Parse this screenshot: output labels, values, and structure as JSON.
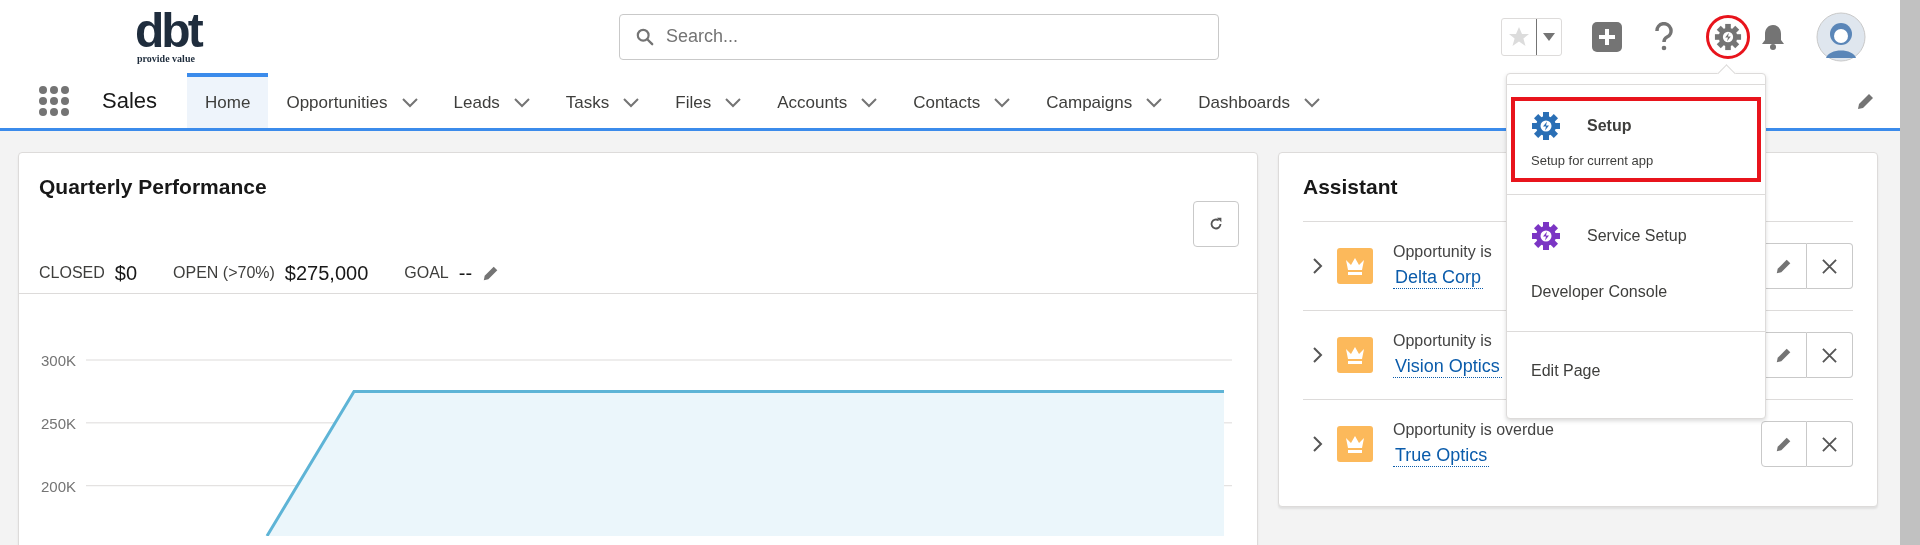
{
  "header": {
    "logo": {
      "mark": "dbt",
      "tagline": "provide value"
    },
    "search": {
      "placeholder": "Search..."
    },
    "setup_gear": {
      "highlighted": true
    }
  },
  "nav": {
    "app_name": "Sales",
    "tabs": [
      {
        "label": "Home",
        "selected": true,
        "has_menu": false
      },
      {
        "label": "Opportunities",
        "selected": false,
        "has_menu": true
      },
      {
        "label": "Leads",
        "selected": false,
        "has_menu": true
      },
      {
        "label": "Tasks",
        "selected": false,
        "has_menu": true
      },
      {
        "label": "Files",
        "selected": false,
        "has_menu": true
      },
      {
        "label": "Accounts",
        "selected": false,
        "has_menu": true
      },
      {
        "label": "Contacts",
        "selected": false,
        "has_menu": true
      },
      {
        "label": "Campaigns",
        "selected": false,
        "has_menu": true
      },
      {
        "label": "Dashboards",
        "selected": false,
        "has_menu": true
      }
    ]
  },
  "quarterly_performance": {
    "title": "Quarterly Performance",
    "metrics": [
      {
        "label": "CLOSED",
        "value": "$0",
        "editable": false
      },
      {
        "label": "OPEN (>70%)",
        "value": "$275,000",
        "editable": false
      },
      {
        "label": "GOAL",
        "value": "--",
        "editable": true
      }
    ],
    "chart_data": {
      "type": "area",
      "categories": [
        null,
        null,
        null,
        null,
        null,
        null,
        null,
        null,
        null,
        null,
        null,
        null
      ],
      "ylim": [
        160000,
        300000
      ],
      "yticks": [
        {
          "value": 300000,
          "label": "300K"
        },
        {
          "value": 250000,
          "label": "250K"
        },
        {
          "value": 200000,
          "label": "200K"
        }
      ],
      "series": [
        {
          "color": "#5eb4d6",
          "values": [
            160000,
            275000,
            275000,
            275000,
            275000,
            275000,
            275000,
            275000,
            275000,
            275000,
            275000,
            275000
          ]
        }
      ]
    }
  },
  "assistant": {
    "title": "Assistant",
    "items": [
      {
        "text": "Opportunity is",
        "link": "Delta Corp"
      },
      {
        "text": "Opportunity is",
        "link": "Vision Optics"
      },
      {
        "text": "Opportunity is overdue",
        "link": "True Optics"
      }
    ]
  },
  "setup_menu": {
    "sections": [
      {
        "items": [
          {
            "kind": "icon",
            "label": "Setup",
            "description": "Setup for current app",
            "color": "#2a6fb5",
            "highlighted": true
          }
        ]
      },
      {
        "items": [
          {
            "kind": "icon",
            "label": "Service Setup",
            "color": "#7b35c4",
            "highlighted": false
          },
          {
            "kind": "plain",
            "label": "Developer Console",
            "highlighted": false
          }
        ]
      },
      {
        "items": [
          {
            "kind": "plain",
            "label": "Edit Page",
            "highlighted": false
          }
        ]
      }
    ]
  }
}
